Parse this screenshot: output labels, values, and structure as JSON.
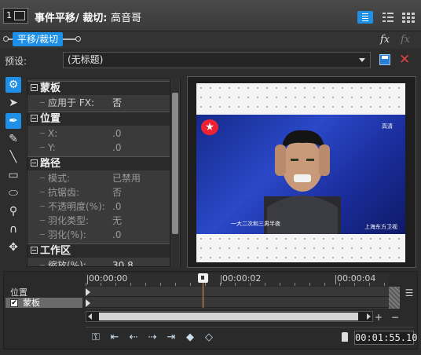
{
  "title_bar": {
    "icon_text": "1",
    "title": "事件平移/ 裁切:",
    "subtitle": "高音哥"
  },
  "chain": {
    "tab_label": "平移/裁切",
    "fx_label": "fx"
  },
  "preset": {
    "label": "预设:",
    "value": "(无标题)"
  },
  "properties": {
    "groups": [
      {
        "name": "蒙板",
        "rows": [
          {
            "name": "应用于 FX:",
            "value": "否",
            "dim": false
          }
        ]
      },
      {
        "name": "位置",
        "rows": [
          {
            "name": "X:",
            "value": ".0",
            "dim": true
          },
          {
            "name": "Y:",
            "value": ".0",
            "dim": true
          }
        ]
      },
      {
        "name": "路径",
        "rows": [
          {
            "name": "模式:",
            "value": "已禁用",
            "dim": true
          },
          {
            "name": "抗锯齿:",
            "value": "否",
            "dim": true
          },
          {
            "name": "不透明度(%):",
            "value": ".0",
            "dim": true
          },
          {
            "name": "羽化类型:",
            "value": "无",
            "dim": true
          },
          {
            "name": "羽化(%):",
            "value": ".0",
            "dim": true
          }
        ]
      },
      {
        "name": "工作区",
        "rows": [
          {
            "name": "缩放(%):",
            "value": "30.8",
            "dim": false
          }
        ]
      }
    ]
  },
  "video": {
    "channel": "高清",
    "subtitle": "一大二次和三男半夜",
    "brand": "上海东方卫视"
  },
  "timeline": {
    "ruler": [
      "00:00:00",
      "00:00:02",
      "00:00:04"
    ],
    "tracks": [
      {
        "label": "位置"
      },
      {
        "label": "蒙板",
        "checked": true
      }
    ],
    "time": "00:01:55.10"
  }
}
